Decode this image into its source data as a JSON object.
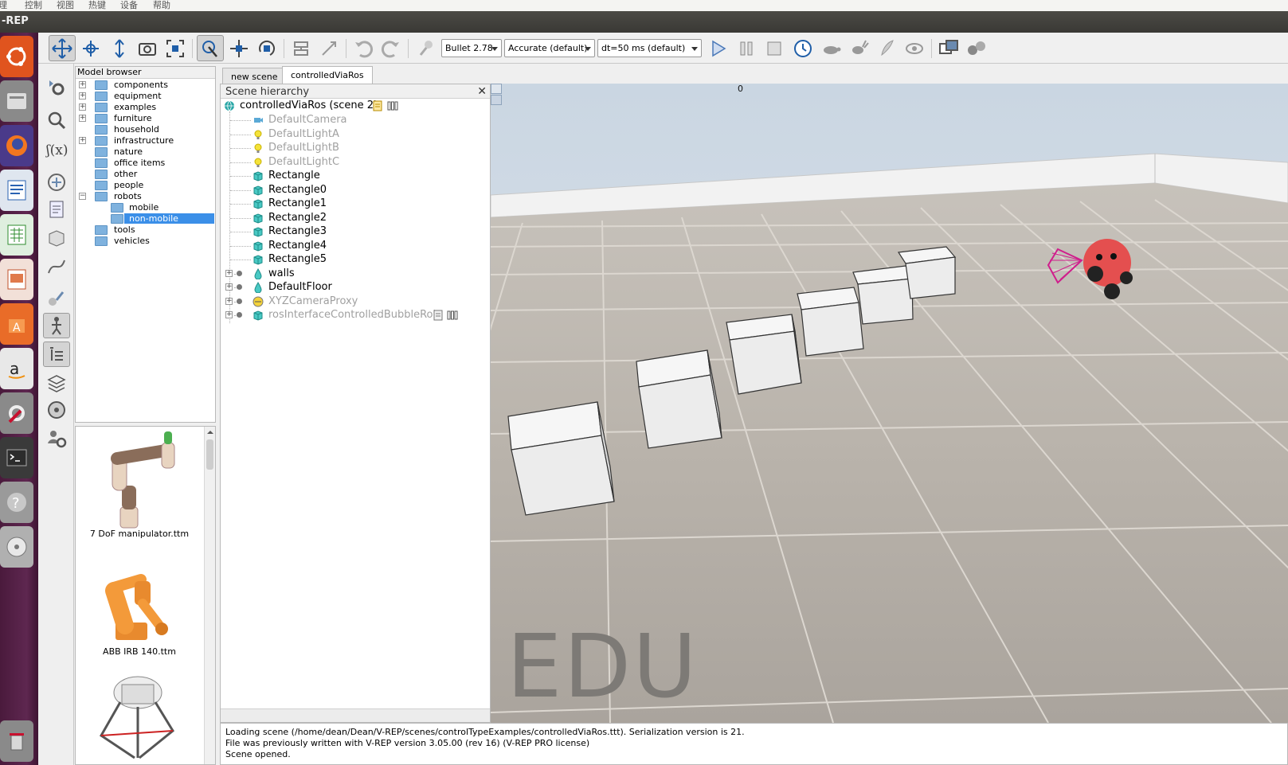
{
  "menu": {
    "items": [
      "理",
      "控制",
      "视图",
      "热键",
      "设备",
      "帮助"
    ]
  },
  "window": {
    "title": "-REP"
  },
  "launcher": {
    "apps": [
      "ubuntu-dash",
      "files",
      "firefox",
      "writer",
      "calc",
      "impress",
      "software-center",
      "amazon",
      "system-settings",
      "terminal",
      "help",
      "dvd",
      "trash"
    ]
  },
  "toolbar": {
    "engine": "Bullet 2.78",
    "accuracy": "Accurate (default)",
    "timestep": "dt=50 ms (default)"
  },
  "model_browser": {
    "title": "Model browser",
    "items": [
      {
        "label": "components",
        "expandable": true
      },
      {
        "label": "equipment",
        "expandable": true
      },
      {
        "label": "examples",
        "expandable": true
      },
      {
        "label": "furniture",
        "expandable": true
      },
      {
        "label": "household",
        "expandable": false
      },
      {
        "label": "infrastructure",
        "expandable": true
      },
      {
        "label": "nature",
        "expandable": false
      },
      {
        "label": "office items",
        "expandable": false
      },
      {
        "label": "other",
        "expandable": false
      },
      {
        "label": "people",
        "expandable": false
      },
      {
        "label": "robots",
        "expandable": true,
        "expanded": true
      },
      {
        "label": "mobile",
        "child": true
      },
      {
        "label": "non-mobile",
        "child": true,
        "selected": true
      },
      {
        "label": "tools",
        "expandable": false
      },
      {
        "label": "vehicles",
        "expandable": false
      }
    ]
  },
  "thumbnails": [
    {
      "caption": "7 DoF manipulator.ttm"
    },
    {
      "caption": "ABB IRB 140.ttm"
    }
  ],
  "tabs": [
    {
      "label": "new scene",
      "active": false
    },
    {
      "label": "controlledViaRos",
      "active": true
    }
  ],
  "hierarchy": {
    "title": "Scene hierarchy",
    "root": "controlledViaRos (scene 2)",
    "items": [
      {
        "label": "DefaultCamera",
        "dim": true,
        "icon": "camera"
      },
      {
        "label": "DefaultLightA",
        "dim": true,
        "icon": "light"
      },
      {
        "label": "DefaultLightB",
        "dim": true,
        "icon": "light"
      },
      {
        "label": "DefaultLightC",
        "dim": true,
        "icon": "light"
      },
      {
        "label": "Rectangle",
        "dim": false,
        "icon": "shape"
      },
      {
        "label": "Rectangle0",
        "dim": false,
        "icon": "shape"
      },
      {
        "label": "Rectangle1",
        "dim": false,
        "icon": "shape"
      },
      {
        "label": "Rectangle2",
        "dim": false,
        "icon": "shape"
      },
      {
        "label": "Rectangle3",
        "dim": false,
        "icon": "shape"
      },
      {
        "label": "Rectangle4",
        "dim": false,
        "icon": "shape"
      },
      {
        "label": "Rectangle5",
        "dim": false,
        "icon": "shape"
      },
      {
        "label": "walls",
        "dim": false,
        "icon": "drop",
        "expandable": true
      },
      {
        "label": "DefaultFloor",
        "dim": false,
        "icon": "drop",
        "expandable": true
      },
      {
        "label": "XYZCameraProxy",
        "dim": true,
        "icon": "proxy",
        "expandable": true
      },
      {
        "label": "rosInterfaceControlledBubbleRob",
        "dim": true,
        "icon": "shape",
        "expandable": true
      }
    ]
  },
  "viewport": {
    "frame_counter": "0",
    "watermark": "EDU"
  },
  "console": {
    "lines": [
      "Loading scene (/home/dean/Dean/V-REP/scenes/controlTypeExamples/controlledViaRos.ttt).  Serialization version is 21.",
      "File was previously written with V-REP version 3.05.00 (rev 16) (V-REP PRO license)",
      "Scene opened."
    ]
  }
}
